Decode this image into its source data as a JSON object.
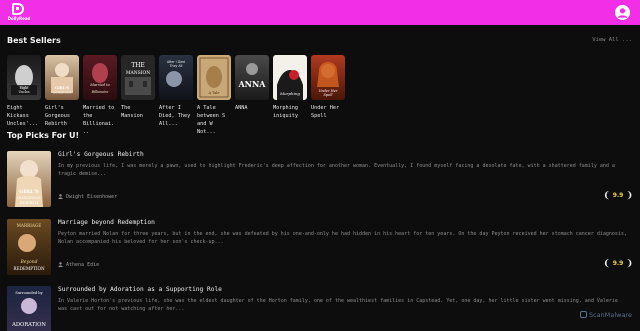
{
  "app": {
    "brand": "DollyRead",
    "accent_color": "#f22fe6"
  },
  "header": {
    "logo_icon": "book-d-logo",
    "profile_icon": "user-avatar-icon"
  },
  "best_sellers": {
    "title": "Best Sellers",
    "view_all": "View All ...",
    "books": [
      {
        "title": "Eight Kickass Uncles'..."
      },
      {
        "title": "Girl's Gorgeous Rebirth"
      },
      {
        "title": "Married to the Billionai..."
      },
      {
        "title": "The Mansion"
      },
      {
        "title": "After I Died, They All..."
      },
      {
        "title": "A Tale between S and W Not..."
      },
      {
        "title": "ANNA"
      },
      {
        "title": "Morphing iniquity"
      },
      {
        "title": "Under Her Spell"
      }
    ]
  },
  "top_picks": {
    "title": "Top Picks For U!",
    "items": [
      {
        "title": "Girl's Gorgeous Rebirth",
        "description": "In my previous life, I was merely a pawn, used to highlight Frederic's deep affection for another woman. Eventually, I found myself facing a desolate fate, with a shattered family and a tragic demise...",
        "author": "Dwight Eisenhower",
        "rating": "9.9"
      },
      {
        "title": "Marriage beyond Redemption",
        "description": "Peyton married Nolan for three years, but in the end, she was defeated by his one-and-only he had hidden in his heart for ten years. On the day Peyton received her stomach cancer diagnosis, Nolan accompanied his beloved for her son's check-up...",
        "author": "Athena Edie",
        "rating": "9.9"
      },
      {
        "title": "Surrounded by Adoration as a Supporting Role",
        "description": "In Valerie Horton's previous life, she was the eldest daughter of the Horton family, one of the wealthiest families in Capstead. Yet, one day, her little sister went missing, and Valerie was cast out for not watching after her...",
        "author": "",
        "rating": ""
      }
    ]
  },
  "cover_art": [
    {
      "lines": [
        "Eight",
        "Kickass",
        "Uncles"
      ]
    },
    {
      "lines": [
        "GIRL'S",
        "GORGEOUS",
        "REBIRTH"
      ]
    },
    {
      "lines": [
        "Married to",
        "the",
        "Billionaire"
      ]
    },
    {
      "lines": [
        "THE",
        "MANSION"
      ]
    },
    {
      "lines": [
        "After I Died",
        "They All"
      ]
    },
    {
      "lines": [
        "A Tale"
      ]
    },
    {
      "lines": [
        "ANNA"
      ]
    },
    {
      "lines": [
        "Morphing"
      ]
    },
    {
      "lines": [
        "Under Her",
        "Spell"
      ]
    }
  ],
  "pick_cover_art": [
    {
      "lines": [
        "GIRL'S",
        "GORGEOUS",
        "REBIRTH"
      ]
    },
    {
      "lines": [
        "MARRIAGE",
        "Beyond",
        "REDEMPTION"
      ]
    },
    {
      "lines": [
        "Surrounded by",
        "ADORATION"
      ]
    }
  ],
  "watermark": {
    "text": "ScanMalware"
  }
}
